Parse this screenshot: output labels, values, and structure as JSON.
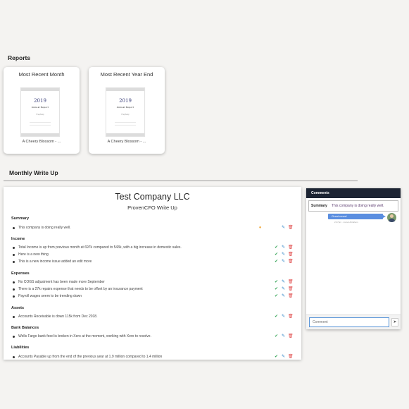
{
  "reports": {
    "heading": "Reports",
    "cards": [
      {
        "title": "Most Recent Month",
        "thumb_year": "2019",
        "thumb_subtitle": "Annual Report",
        "thumb_line": "PrepAway",
        "caption": "A Cheery Blossom - ..."
      },
      {
        "title": "Most Recent Year End",
        "thumb_year": "2019",
        "thumb_subtitle": "Annual Report",
        "thumb_line": "PrepAway",
        "caption": "A Cheery Blossom - ..."
      }
    ]
  },
  "writeup": {
    "heading": "Monthly Write Up",
    "company": "Test Company LLC",
    "subtitle": "ProvenCFO Write Up",
    "sections": [
      {
        "title": "Summary",
        "items": [
          "This company is doing really well."
        ]
      },
      {
        "title": "Income",
        "items": [
          "Total Income is up from previous month at 697k compared to 543k, with a big increase in domestic sales.",
          "Here is a new thing",
          "This is a new income issue added an edit more"
        ]
      },
      {
        "title": "Expenses",
        "items": [
          "No COGS adjustment has been made more September",
          "There is a 27k repairs expense that needs to be offset by an insurance payment",
          "Payroll wages seem to be trending down"
        ]
      },
      {
        "title": "Assets",
        "items": [
          "Accounts Receivable is down 115k from Dec 2018."
        ]
      },
      {
        "title": "Bank Balances",
        "items": [
          "Wells Fargo bank feed is broken in Xero at the moment, working with Xero to resolve."
        ]
      },
      {
        "title": "Liabilities",
        "items": [
          "Accounts Payable up from the end of the previous year at 1.9 million compared to 1.4 million"
        ]
      }
    ],
    "icons": {
      "check": "check-icon",
      "edit": "pencil-icon",
      "delete": "trash-icon",
      "comment": "comment-icon"
    },
    "colors": {
      "check": "#3aa65a",
      "edit": "#2f86c8",
      "delete": "#e04848",
      "comment": "#f2a93b"
    }
  },
  "comments": {
    "header": "Comments",
    "summary_label": "Summary",
    "summary_text": "This company is doing really well.",
    "message": "Great news!",
    "message_meta": "2:47pm · Lionel Abraham",
    "input_placeholder": "Comment",
    "send_icon": "send-icon",
    "header_color": "#1c2433",
    "bubble_color": "#5a8ee0"
  }
}
